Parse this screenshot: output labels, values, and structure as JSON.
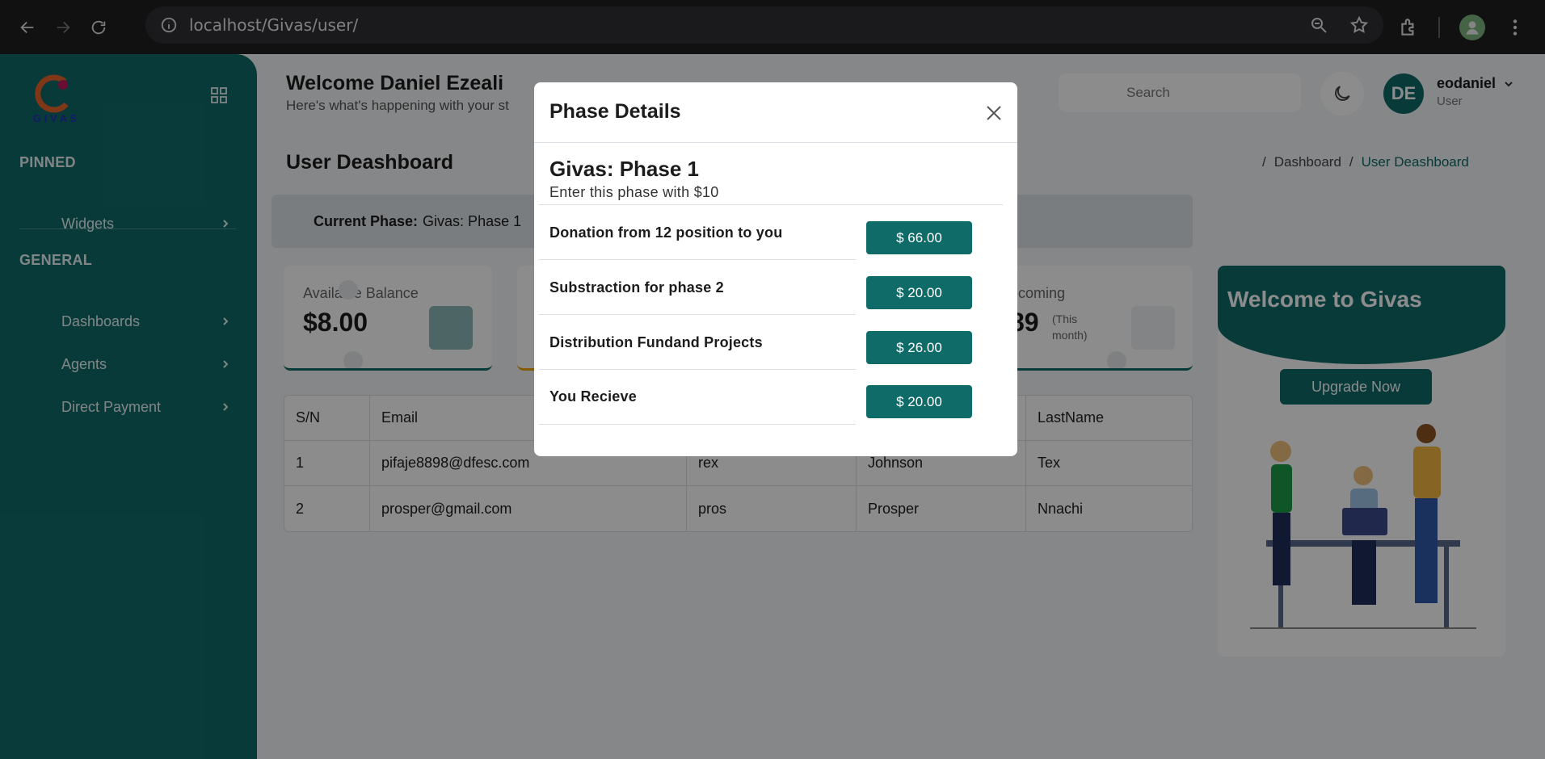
{
  "browser": {
    "url": "localhost/Givas/user/"
  },
  "sidebar": {
    "logo_text": "GIVAS",
    "sections": [
      {
        "title": "PINNED",
        "items": [
          {
            "label": "Widgets"
          }
        ]
      },
      {
        "title": "GENERAL",
        "items": [
          {
            "label": "Dashboards"
          },
          {
            "label": "Agents"
          },
          {
            "label": "Direct Payment"
          }
        ]
      }
    ]
  },
  "header": {
    "welcome": "Welcome Daniel Ezeali",
    "subtitle": "Here's what's happening with your st",
    "search_placeholder": "Search",
    "user": {
      "initials": "DE",
      "name": "eodaniel",
      "role": "User"
    }
  },
  "page": {
    "title": "User Deashboard",
    "breadcrumbs": [
      "Dashboard",
      "User Deashboard"
    ],
    "current_phase_label": "Current Phase:",
    "current_phase_value": "Givas: Phase 1",
    "cards": {
      "balance_label": "Available Balance",
      "balance_value": "$8.00",
      "upcoming_label": "pcoming",
      "upcoming_value": "89",
      "upcoming_note": "(This month)"
    },
    "table": {
      "headers": [
        "S/N",
        "Email",
        "",
        "",
        "LastName"
      ],
      "rows": [
        [
          "1",
          "pifaje8898@dfesc.com",
          "rex",
          "Johnson",
          "Tex"
        ],
        [
          "2",
          "prosper@gmail.com",
          "pros",
          "Prosper",
          "Nnachi"
        ]
      ]
    },
    "promo": {
      "title": "Welcome to Givas",
      "button": "Upgrade Now"
    }
  },
  "modal": {
    "title": "Phase Details",
    "phase_name": "Givas: Phase 1",
    "phase_desc": "Enter this phase with $10",
    "rows": [
      {
        "label": "Donation from 12 position to you",
        "amount": "$ 66.00"
      },
      {
        "label": "Substraction for phase 2",
        "amount": "$ 20.00"
      },
      {
        "label": "Distribution Fundand Projects",
        "amount": "$ 26.00"
      },
      {
        "label": "You Recieve",
        "amount": "$ 20.00"
      }
    ]
  },
  "colors": {
    "brand": "#0f6b68",
    "overlay": "rgba(0,0,0,0.45)"
  }
}
